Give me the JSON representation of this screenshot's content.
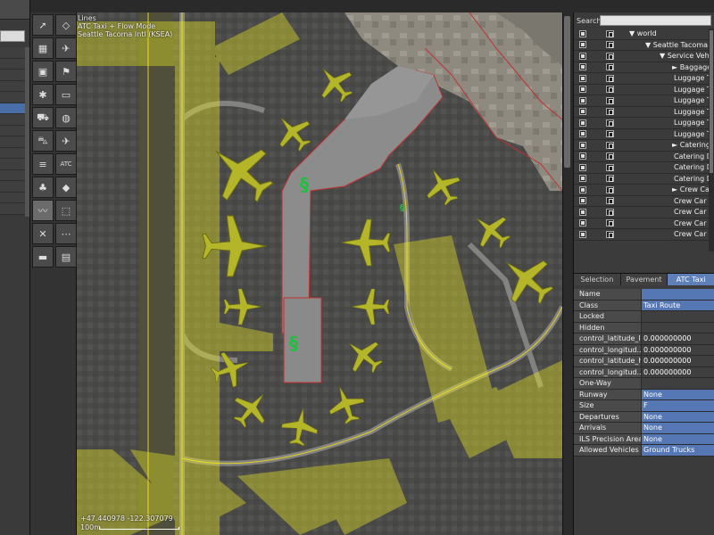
{
  "toolbar": {
    "tools": [
      {
        "icon": "select-arrow-icon",
        "glyph": "➚"
      },
      {
        "icon": "vertex-tool-icon",
        "glyph": "◇"
      },
      {
        "icon": "marquee-tool-icon",
        "glyph": "▦"
      },
      {
        "icon": "airport-beacon-icon",
        "glyph": "✈"
      },
      {
        "icon": "object-tool-icon",
        "glyph": "▣"
      },
      {
        "icon": "windsock-icon",
        "glyph": "⚑"
      },
      {
        "icon": "light-fixture-icon",
        "glyph": "✱"
      },
      {
        "icon": "sign-tool-icon",
        "glyph": "▭"
      },
      {
        "icon": "truck-parking-icon",
        "glyph": "⛟"
      },
      {
        "icon": "runway-light-icon",
        "glyph": "◍"
      },
      {
        "icon": "vehicle-tool-icon",
        "glyph": "⛍"
      },
      {
        "icon": "airplane-start-icon",
        "glyph": "✈"
      },
      {
        "icon": "line-marking-icon",
        "glyph": "≡"
      },
      {
        "icon": "atc-flow-icon",
        "glyph": "ATC"
      },
      {
        "icon": "tree-forest-icon",
        "glyph": "♣"
      },
      {
        "icon": "draped-polygon-icon",
        "glyph": "◆"
      },
      {
        "icon": "taxi-route-icon",
        "glyph": "〰"
      },
      {
        "icon": "boundary-icon",
        "glyph": "⬚"
      },
      {
        "icon": "exclusion-zone-icon",
        "glyph": "✕"
      },
      {
        "icon": "object-string-icon",
        "glyph": "⋯"
      },
      {
        "icon": "ruler-tool-icon",
        "glyph": "▬"
      },
      {
        "icon": "facade-tool-icon",
        "glyph": "▤"
      }
    ]
  },
  "map": {
    "overlay": {
      "mode_label": "Lines",
      "mode_name": "ATC Taxi + Flow Mode",
      "airport": "Seattle Tacoma Intl (KSEA)"
    },
    "coords": "+47.440978 -122.307079",
    "scale": "100m"
  },
  "right_panel": {
    "search_label": "Search",
    "search_value": "",
    "tree": [
      {
        "label": "▼ world",
        "indent": 62
      },
      {
        "label": "▼ Seattle Tacoma I",
        "indent": 80
      },
      {
        "label": "▼ Service Vehic",
        "indent": 96
      },
      {
        "label": "► Baggage",
        "indent": 110
      },
      {
        "label": "Luggage T",
        "indent": 112
      },
      {
        "label": "Luggage T",
        "indent": 112
      },
      {
        "label": "Luggage T",
        "indent": 112
      },
      {
        "label": "Luggage T",
        "indent": 112
      },
      {
        "label": "Luggage T",
        "indent": 112
      },
      {
        "label": "Luggage T",
        "indent": 112
      },
      {
        "label": "► Catering",
        "indent": 110
      },
      {
        "label": "Catering D",
        "indent": 112
      },
      {
        "label": "Catering D",
        "indent": 112
      },
      {
        "label": "Catering D",
        "indent": 112
      },
      {
        "label": "► Crew Ca",
        "indent": 110
      },
      {
        "label": "Crew Car D",
        "indent": 112
      },
      {
        "label": "Crew Car D",
        "indent": 112
      },
      {
        "label": "Crew Car D",
        "indent": 112
      },
      {
        "label": "Crew Car D",
        "indent": 112
      }
    ],
    "tabs": [
      "Selection",
      "Pavement",
      "ATC Taxi"
    ],
    "properties": [
      {
        "name": "Name",
        "value": "",
        "blue": true
      },
      {
        "name": "Class",
        "value": "Taxi Route",
        "blue": true
      },
      {
        "name": "Locked",
        "value": "",
        "blue": false
      },
      {
        "name": "Hidden",
        "value": "",
        "blue": false
      },
      {
        "name": "control_latitude_lo",
        "value": "0.000000000",
        "blue": false
      },
      {
        "name": "control_longitud...",
        "value": "0.000000000",
        "blue": false
      },
      {
        "name": "control_latitude_hi",
        "value": "0.000000000",
        "blue": false
      },
      {
        "name": "control_longitud...",
        "value": "0.000000000",
        "blue": false
      },
      {
        "name": "One-Way",
        "value": "",
        "blue": false
      },
      {
        "name": "Runway",
        "value": "None",
        "blue": true
      },
      {
        "name": "Size",
        "value": "F",
        "blue": true
      },
      {
        "name": "Departures",
        "value": "None",
        "blue": true
      },
      {
        "name": "Arrivals",
        "value": "None",
        "blue": true
      },
      {
        "name": "ILS Precision Area",
        "value": "None",
        "blue": true
      },
      {
        "name": "Allowed Vehicles",
        "value": "Ground Trucks",
        "blue": true
      }
    ]
  },
  "colors": {
    "accent": "#5577b3",
    "airplane": "#b5b52a",
    "flow_overlay": "#f0f020",
    "taxi_line": "#e6d11f"
  }
}
